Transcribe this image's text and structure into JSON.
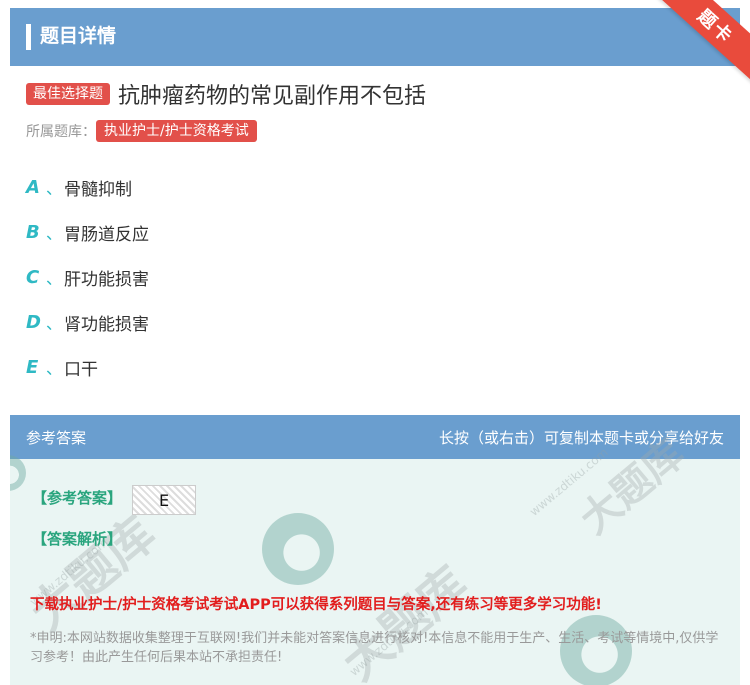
{
  "header": {
    "title": "题目详情",
    "ribbon_label": "题卡"
  },
  "question": {
    "type_label": "最佳选择题",
    "text": "抗肿瘤药物的常见副作用不包括",
    "bank_label": "所属题库：",
    "bank_name": "执业护士/护士资格考试"
  },
  "options": [
    {
      "letter": "A",
      "sep": "、",
      "text": "骨髓抑制"
    },
    {
      "letter": "B",
      "sep": "、",
      "text": "胃肠道反应"
    },
    {
      "letter": "C",
      "sep": "、",
      "text": "肝功能损害"
    },
    {
      "letter": "D",
      "sep": "、",
      "text": "肾功能损害"
    },
    {
      "letter": "E",
      "sep": "、",
      "text": "口干"
    }
  ],
  "answer": {
    "head_left": "参考答案",
    "head_right": "长按（或右击）可复制本题卡或分享给好友",
    "answer_label": "【参考答案】",
    "answer_value": "E",
    "analysis_label": "【答案解析】",
    "promo": "下载执业护士/护士资格考试考试APP可以获得系列题目与答案,还有练习等更多学习功能!",
    "disclaimer": "*申明:本网站数据收集整理于互联网!我们并未能对答案信息进行核对!本信息不能用于生产、生活、考试等情境中,仅供学习参考！由此产生任何后果本站不承担责任!"
  },
  "watermark": {
    "brand": "大题库",
    "url": "www.zdtiku.com"
  },
  "colors": {
    "header_bg": "#6a9ecf",
    "tag_red": "#e2504a",
    "option_letter": "#2fb9c4",
    "answer_green": "#2aa57e",
    "promo_red": "#e21d1d"
  }
}
